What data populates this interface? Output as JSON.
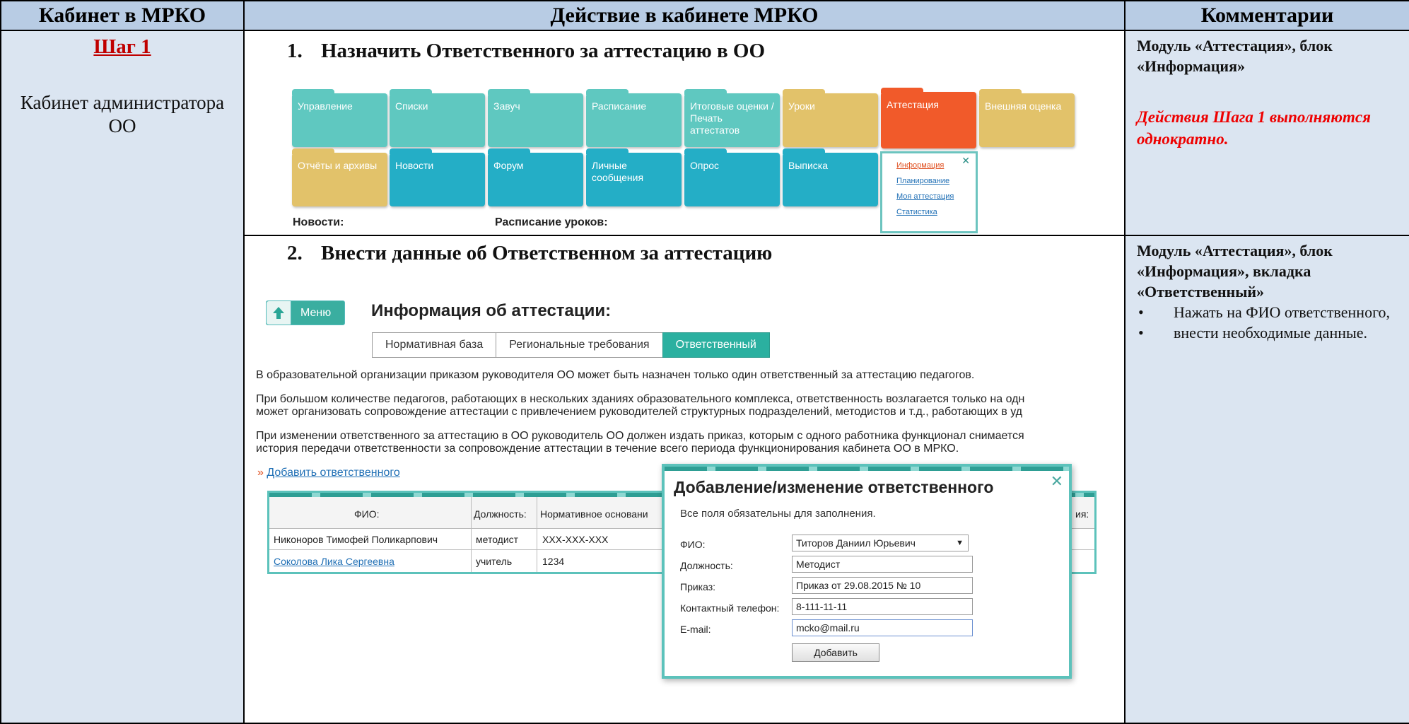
{
  "table": {
    "headers": [
      "Кабинет в МРКО",
      "Действие в кабинете МРКО",
      "Комментарии"
    ],
    "col1": {
      "step": "Шаг 1",
      "cabinet": "Кабинет администратора ОО"
    },
    "row1": {
      "num": "1.",
      "heading": "Назначить Ответственного за аттестацию в ОО",
      "comment_title": "Модуль «Аттестация», блок «Информация»",
      "comment_red": "Действия Шага 1 выполняются однократно."
    },
    "row2": {
      "num": "2.",
      "heading": "Внести данные об Ответственном за аттестацию",
      "comment_title": "Модуль «Аттестация», блок «Информация», вкладка «Ответственный»",
      "bullets": [
        "Нажать на ФИО ответственного,",
        "внести необходимые данные."
      ]
    }
  },
  "menu": {
    "tiles_row1": [
      "Управление",
      "Списки",
      "Завуч",
      "Расписание",
      "Итоговые оценки / Печать аттестатов",
      "Уроки",
      "Аттестация",
      "Внешняя оценка"
    ],
    "tiles_row2": [
      "Отчёты и архивы",
      "Новости",
      "Форум",
      "Личные сообщения",
      "Опрос",
      "Выписка"
    ],
    "popup_items": [
      "Информация",
      "Планирование",
      "Моя аттестация",
      "Статистика"
    ],
    "popup_close": "✕",
    "news_label": "Новости:",
    "schedule_label": "Расписание уроков:"
  },
  "attest": {
    "menu_button": "Меню",
    "title": "Информация об аттестации:",
    "tabs": [
      "Нормативная база",
      "Региональные требования",
      "Ответственный"
    ],
    "paragraphs": [
      "В образовательной организации приказом руководителя ОО может быть назначен только один ответственный за аттестацию педагогов.",
      "При большом количестве педагогов, работающих в нескольких зданиях образовательного комплекса, ответственность возлагается только на одн",
      "может организовать сопровождение аттестации с привлечением руководителей структурных подразделений, методистов и т.д., работающих в уд",
      "При изменении ответственного за аттестацию в ОО руководитель ОО должен издать приказ, которым с одного работника функционал снимается",
      "история передачи ответственности за сопровождение аттестации в течение всего периода функционирования кабинета ОО в МРКО."
    ],
    "add_link_marker": "»",
    "add_link": "Добавить ответственного",
    "grid": {
      "columns": [
        "ФИО:",
        "Должность:",
        "Нормативное основани",
        "ия:"
      ],
      "rows": [
        [
          "Никоноров Тимофей Поликарпович",
          "методист",
          "XXX-XXX-XXX"
        ],
        [
          "Соколова Лика Сергеевна",
          "учитель",
          "1234"
        ]
      ]
    }
  },
  "modal": {
    "title": "Добавление/изменение ответственного",
    "close": "✕",
    "note": "Все поля обязательны для заполнения.",
    "fields": {
      "fio_label": "ФИО:",
      "fio_value": "Титоров Даниил Юрьевич",
      "position_label": "Должность:",
      "position_value": "Методист",
      "order_label": "Приказ:",
      "order_value": "Приказ от 29.08.2015 № 10",
      "phone_label": "Контактный телефон:",
      "phone_value": "8-111-11-11",
      "email_label": "E-mail:",
      "email_value": "mcko@mail.ru"
    },
    "submit": "Добавить"
  },
  "colors": {
    "header_bg": "#b8cce4",
    "side_bg": "#dbe5f1",
    "accent_teal": "#5cc2bb",
    "active_tile": "#f15a2a",
    "red_text": "#e00000"
  }
}
